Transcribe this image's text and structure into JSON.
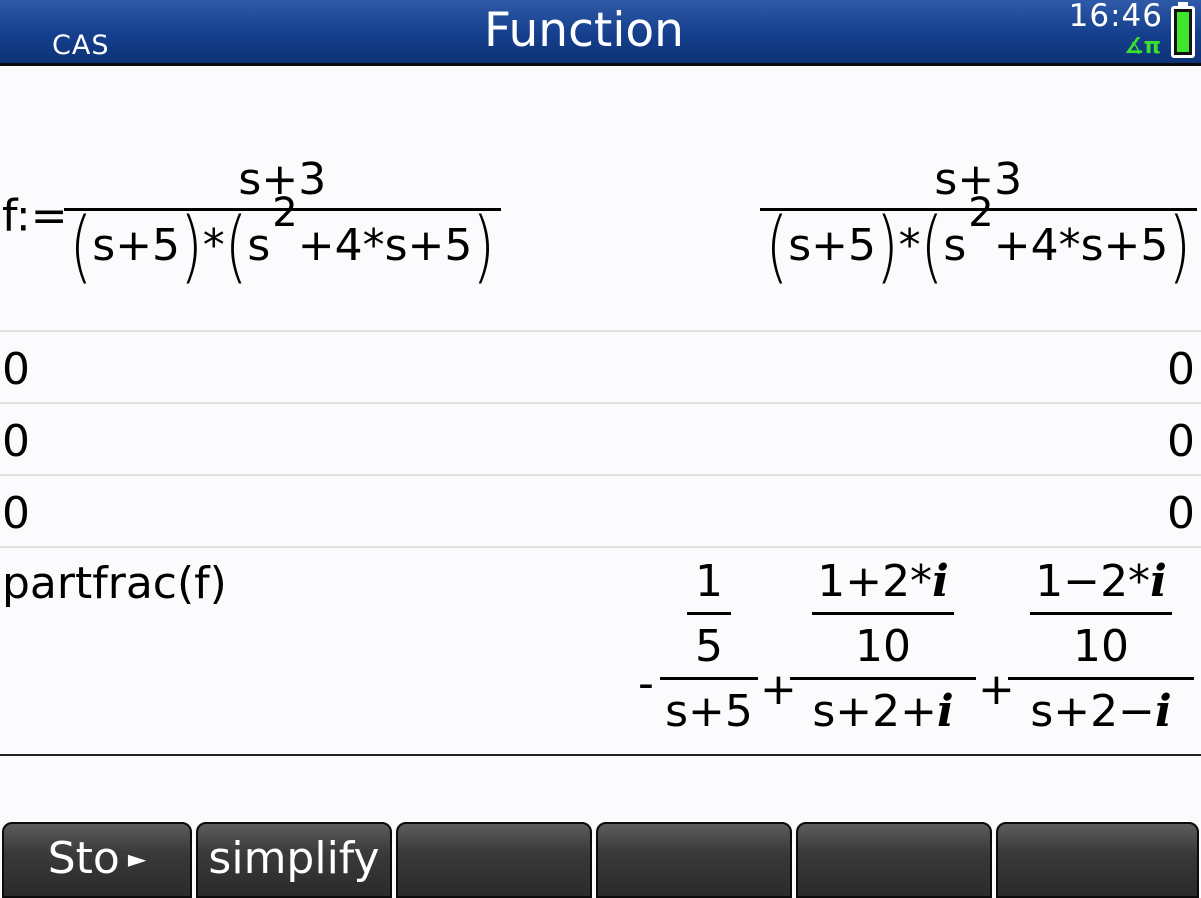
{
  "header": {
    "mode": "CAS",
    "title": "Function",
    "time": "16:46",
    "angle_indicator": "∡π",
    "battery_color": "#3ee52a"
  },
  "history": {
    "row1": {
      "input_prefix": "f:=",
      "numerator": "s+3",
      "den_a": "s+5",
      "times": "*",
      "den_b_base": "s",
      "den_b_exp": "2",
      "den_b_rest": "+4*s+5"
    },
    "row2": {
      "input": "0",
      "output": "0"
    },
    "row3": {
      "input": "0",
      "output": "0"
    },
    "row4": {
      "input": "0",
      "output": "0"
    },
    "row5": {
      "input": "partfrac(f)",
      "term1_sign": "-",
      "term1_num_top": "1",
      "term1_num_bottom": "5",
      "term1_den": "s+5",
      "plus": "+",
      "term2_num_top": "1+2*",
      "term2_num_i": "i",
      "term2_num_bottom": "10",
      "term2_den": "s+2+",
      "term2_den_i": "i",
      "term3_num_top": "1−2*",
      "term3_num_i": "i",
      "term3_num_bottom": "10",
      "term3_den": "s+2−",
      "term3_den_i": "i"
    }
  },
  "softkeys": {
    "sto": "Sto",
    "sto_arrow": "►",
    "simplify": "simplify",
    "k3": "",
    "k4": "",
    "k5": "",
    "k6": ""
  }
}
